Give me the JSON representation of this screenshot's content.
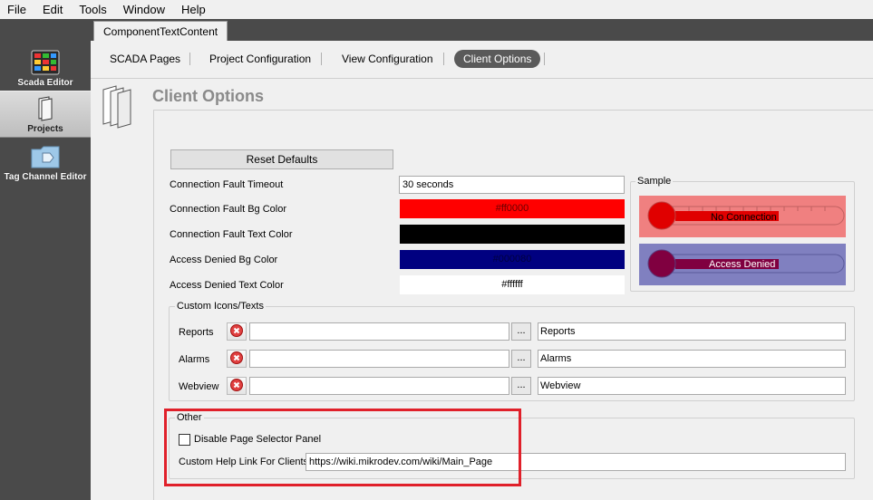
{
  "menu": [
    "File",
    "Edit",
    "Tools",
    "Window",
    "Help"
  ],
  "sidebar": {
    "items": [
      {
        "label": "Scada Editor",
        "icon": "scada-editor-icon"
      },
      {
        "label": "Projects",
        "icon": "projects-icon"
      },
      {
        "label": "Tag Channel Editor",
        "icon": "tag-channel-editor-icon"
      }
    ]
  },
  "doc_tab": "ComponentTextContent",
  "subtabs": [
    "SCADA Pages",
    "Project Configuration",
    "View Configuration",
    "Client Options"
  ],
  "active_subtab": "Client Options",
  "page": {
    "title": "Client Options"
  },
  "form": {
    "reset_label": "Reset Defaults",
    "connection_fault_timeout_label": "Connection Fault Timeout",
    "connection_fault_timeout_value": "30 seconds",
    "connection_fault_bg_label": "Connection Fault Bg Color",
    "connection_fault_bg_value": "#ff0000",
    "connection_fault_text_label": "Connection Fault Text Color",
    "connection_fault_text_value": "#000000",
    "access_denied_bg_label": "Access Denied Bg Color",
    "access_denied_bg_value": "#000080",
    "access_denied_text_label": "Access Denied Text Color",
    "access_denied_text_value": "#ffffff"
  },
  "sample": {
    "title": "Sample",
    "no_connection": "No Connection",
    "access_denied": "Access Denied"
  },
  "custom": {
    "title": "Custom Icons/Texts",
    "browse_label": "...",
    "rows": [
      {
        "label": "Reports",
        "text": "Reports"
      },
      {
        "label": "Alarms",
        "text": "Alarms"
      },
      {
        "label": "Webview",
        "text": "Webview"
      }
    ]
  },
  "other": {
    "title": "Other",
    "disable_label": "Disable Page Selector Panel",
    "disable_checked": false,
    "help_label": "Custom Help Link For Clients",
    "help_value": "https://wiki.mikrodev.com/wiki/Main_Page"
  },
  "colors": {
    "sidebar_bg": "#4a4a4a",
    "fault_sample_bg": "#f08080",
    "denied_sample_bg": "#8080c0",
    "highlight": "#e0202a"
  }
}
